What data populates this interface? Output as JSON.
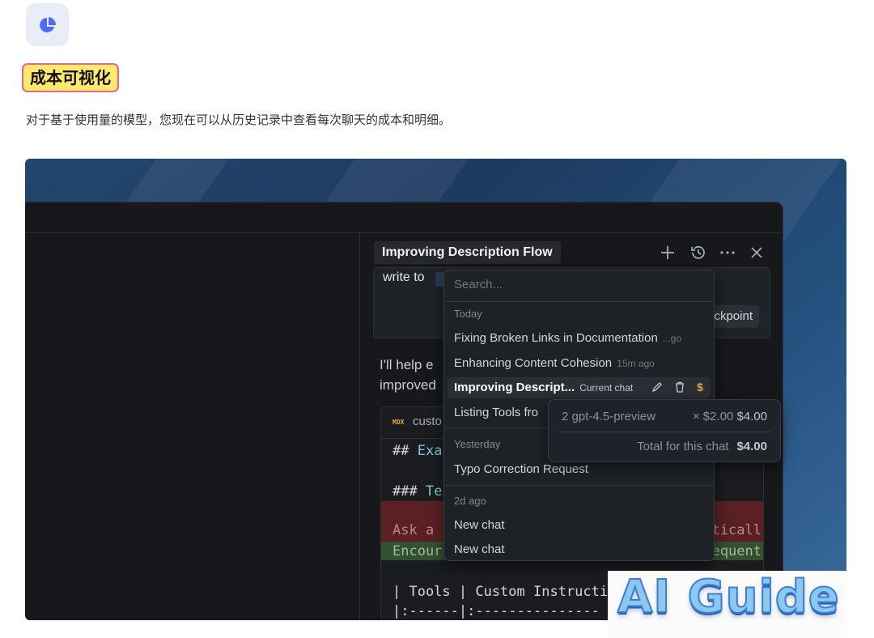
{
  "feature": {
    "icon": "pie-chart-icon",
    "title": "成本可视化",
    "description": "对于基于使用量的模型，您现在可以从历史记录中查看每次聊天的成本和明细。"
  },
  "screenshot": {
    "chat_title": "Improving Description Flow",
    "toolbar_icons": [
      "plus-icon",
      "history-icon",
      "more-icon",
      "close-icon"
    ],
    "message": {
      "write_to": "write to",
      "checkpoint_label": "ckpoint"
    },
    "reply_lines": [
      "I'll help e",
      "improved"
    ],
    "code": {
      "file_badge": "MDX",
      "file_name": "custo",
      "lines": {
        "l1_prefix": "## ",
        "l1_hl": "Exa",
        "l2_prefix": "### ",
        "l2_hl": "Te",
        "red_text": "Ask a",
        "red_tail": "aticall",
        "green_text": "Encour",
        "green_tail": "equent",
        "l5": "| Tools | Custom Instructi",
        "l6": "|:------|:---------------"
      }
    },
    "history": {
      "search_placeholder": "Search...",
      "sections": [
        {
          "label": "Today",
          "items": [
            {
              "title": "Fixing Broken Links in Documentation",
              "meta": "...go"
            },
            {
              "title": "Enhancing Content Cohesion",
              "meta": "15m ago"
            },
            {
              "title": "Improving Descript...",
              "meta": "Current chat",
              "current": true
            },
            {
              "title": "Listing Tools fro",
              "meta": ""
            }
          ]
        },
        {
          "label": "Yesterday",
          "items": [
            {
              "title": "Typo Correction Request",
              "meta": ""
            }
          ]
        },
        {
          "label": "2d ago",
          "items": [
            {
              "title": "New chat",
              "meta": ""
            },
            {
              "title": "New chat",
              "meta": ""
            }
          ]
        }
      ],
      "current_actions": [
        "edit-icon",
        "trash-icon",
        "dollar-icon"
      ]
    },
    "cost": {
      "count": "2",
      "model": "gpt-4.5-preview",
      "unit_price": "× $2.00",
      "subtotal": "$4.00",
      "total_label": "Total for this chat",
      "total": "$4.00"
    }
  },
  "watermark": "AI Guide",
  "colors": {
    "accent": "#4d6bfe",
    "highlight": "#fde96e",
    "cost_icon": "#e3a940"
  }
}
